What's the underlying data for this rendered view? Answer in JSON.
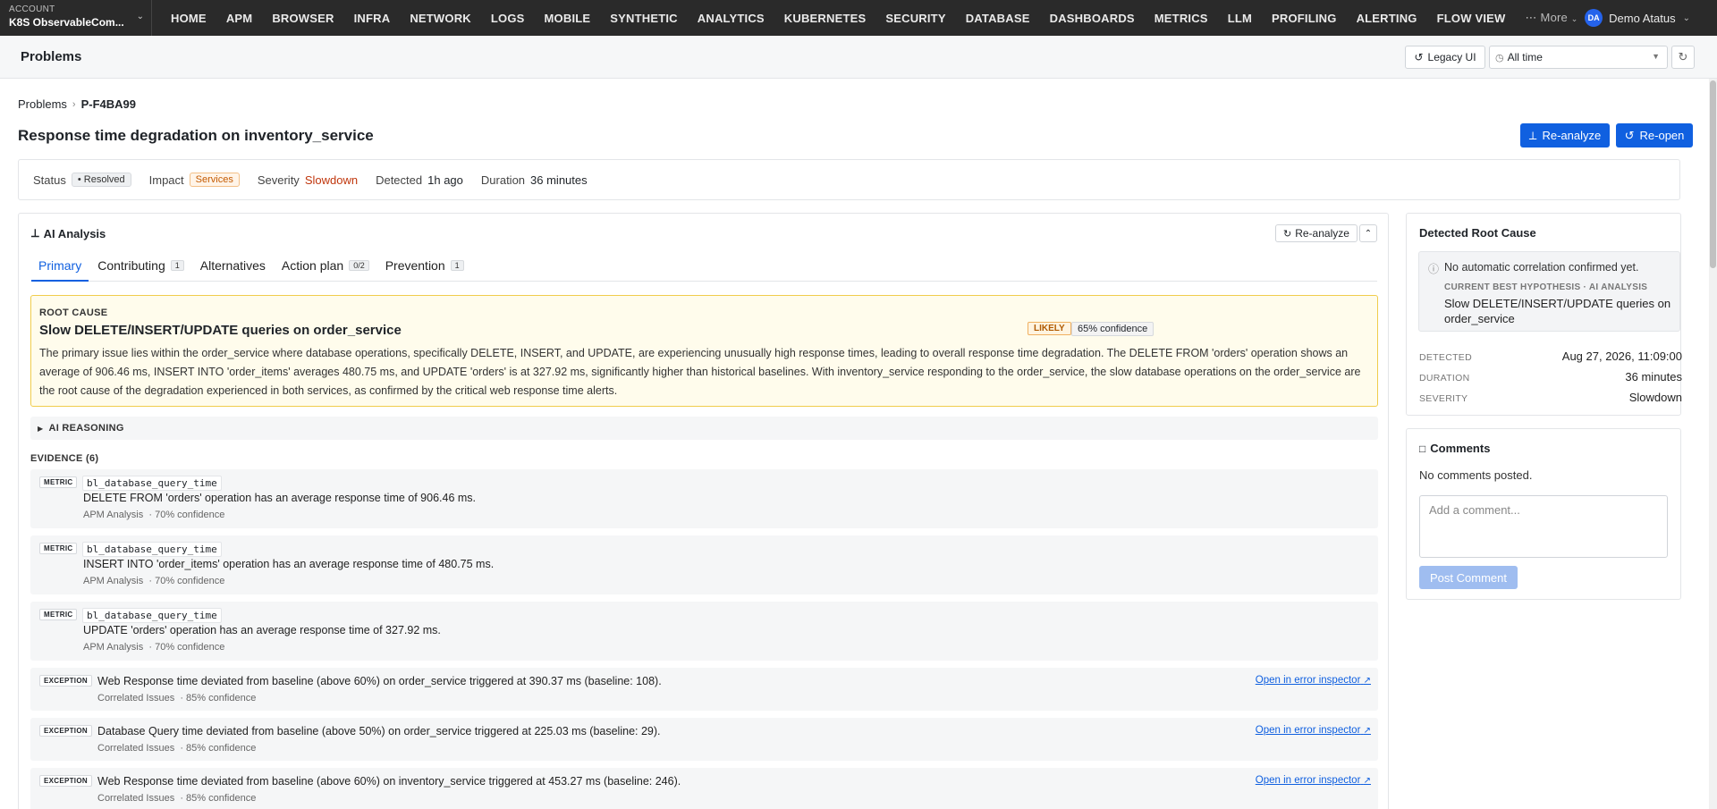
{
  "account": {
    "label": "ACCOUNT",
    "name": "K8S ObservableCom..."
  },
  "nav": {
    "items": [
      "HOME",
      "APM",
      "BROWSER",
      "INFRA",
      "NETWORK",
      "LOGS",
      "MOBILE",
      "SYNTHETIC",
      "ANALYTICS",
      "KUBERNETES",
      "SECURITY",
      "DATABASE",
      "DASHBOARDS",
      "METRICS",
      "LLM",
      "PROFILING",
      "ALERTING",
      "FLOW VIEW"
    ],
    "more": "More",
    "user_initials": "DA",
    "user_name": "Demo Atatus"
  },
  "header": {
    "title": "Problems",
    "legacy_label": "Legacy UI",
    "time_range": "All time"
  },
  "breadcrumb": {
    "root": "Problems",
    "current": "P-F4BA99"
  },
  "problem": {
    "title": "Response time degradation on inventory_service",
    "reanalyze_label": "Re-analyze",
    "reopen_label": "Re-open"
  },
  "status": {
    "status_key": "Status",
    "status_val": "Resolved",
    "impact_key": "Impact",
    "impact_val": "Services",
    "severity_key": "Severity",
    "severity_val": "Slowdown",
    "detected_key": "Detected",
    "detected_val": "1h ago",
    "duration_key": "Duration",
    "duration_val": "36 minutes"
  },
  "ai": {
    "title": "AI Analysis",
    "reanalyze_label": "Re-analyze",
    "tabs": [
      {
        "label": "Primary",
        "badge": ""
      },
      {
        "label": "Contributing",
        "badge": "1"
      },
      {
        "label": "Alternatives",
        "badge": ""
      },
      {
        "label": "Action plan",
        "badge": "0/2"
      },
      {
        "label": "Prevention",
        "badge": "1"
      }
    ],
    "root_cause": {
      "label": "ROOT CAUSE",
      "title": "Slow DELETE/INSERT/UPDATE queries on order_service",
      "likely": "LIKELY",
      "confidence": "65% confidence",
      "body": "The primary issue lies within the order_service where database operations, specifically DELETE, INSERT, and UPDATE, are experiencing unusually high response times, leading to overall response time degradation. The DELETE FROM 'orders' operation shows an average of 906.46 ms, INSERT INTO 'order_items' averages 480.75 ms, and UPDATE 'orders' is at 327.92 ms, significantly higher than historical baselines. With inventory_service responding to the order_service, the slow database operations on the order_service are the root cause of the degradation experienced in both services, as confirmed by the critical web response time alerts."
    },
    "reasoning_label": "AI REASONING",
    "evidence_label": "EVIDENCE (6)",
    "evidence": [
      {
        "type": "METRIC",
        "metric": "bl_database_query_time",
        "desc": "DELETE FROM 'orders' operation has an average response time of 906.46 ms.",
        "meta": "APM Analysis  · 70% confidence",
        "link": ""
      },
      {
        "type": "METRIC",
        "metric": "bl_database_query_time",
        "desc": "INSERT INTO 'order_items' operation has an average response time of 480.75 ms.",
        "meta": "APM Analysis  · 70% confidence",
        "link": ""
      },
      {
        "type": "METRIC",
        "metric": "bl_database_query_time",
        "desc": "UPDATE 'orders' operation has an average response time of 327.92 ms.",
        "meta": "APM Analysis  · 70% confidence",
        "link": ""
      },
      {
        "type": "EXCEPTION",
        "metric": "",
        "desc": "Web Response time deviated from baseline (above 60%) on order_service triggered at 390.37 ms (baseline: 108).",
        "meta": "Correlated Issues  · 85% confidence",
        "link": "Open in error inspector"
      },
      {
        "type": "EXCEPTION",
        "metric": "",
        "desc": "Database Query time deviated from baseline (above 50%) on order_service triggered at 225.03 ms (baseline: 29).",
        "meta": "Correlated Issues  · 85% confidence",
        "link": "Open in error inspector"
      },
      {
        "type": "EXCEPTION",
        "metric": "",
        "desc": "Web Response time deviated from baseline (above 60%) on inventory_service triggered at 453.27 ms (baseline: 246).",
        "meta": "Correlated Issues  · 85% confidence",
        "link": "Open in error inspector"
      }
    ]
  },
  "root_cause_panel": {
    "title": "Detected Root Cause",
    "no_corr": "No automatic correlation confirmed yet.",
    "hyp_label": "CURRENT BEST HYPOTHESIS · AI ANALYSIS",
    "hyp_text": "Slow DELETE/INSERT/UPDATE queries on order_service",
    "detected_key": "DETECTED",
    "detected_val": "Aug 27, 2026, 11:09:00",
    "duration_key": "DURATION",
    "duration_val": "36 minutes",
    "severity_key": "SEVERITY",
    "severity_val": "Slowdown"
  },
  "comments": {
    "title": "Comments",
    "none": "No comments posted.",
    "placeholder": "Add a comment...",
    "post_label": "Post Comment"
  }
}
